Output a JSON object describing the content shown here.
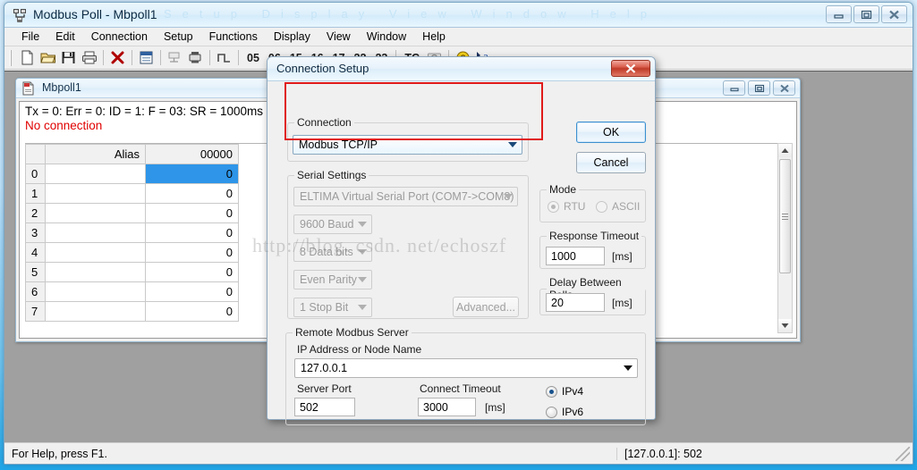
{
  "window": {
    "title": "Modbus Poll - Mbpoll1",
    "app_icon": "modbus-poll-icon",
    "controls": [
      {
        "name": "minimize-button",
        "glyph": "minimize-icon"
      },
      {
        "name": "restore-button",
        "glyph": "restore-icon"
      },
      {
        "name": "close-button",
        "glyph": "close-icon"
      }
    ]
  },
  "menubar": {
    "items": [
      {
        "label": "File"
      },
      {
        "label": "Edit"
      },
      {
        "label": "Connection"
      },
      {
        "label": "Setup"
      },
      {
        "label": "Functions"
      },
      {
        "label": "Display"
      },
      {
        "label": "View"
      },
      {
        "label": "Window"
      },
      {
        "label": "Help"
      }
    ]
  },
  "toolbar": {
    "icons": [
      "new-document-icon",
      "open-folder-icon",
      "save-disk-icon",
      "print-icon",
      "delete-red-x-icon",
      "window-properties-icon",
      "read-write-definition-icon",
      "poll-device-icon",
      "pulse-signal-icon"
    ],
    "function_codes": [
      "05",
      "06",
      "15",
      "16",
      "17",
      "22",
      "23"
    ],
    "tc_label": "TC",
    "tail_icons": [
      "camera-icon",
      "about-help-icon",
      "context-help-icon"
    ]
  },
  "child_window": {
    "title": "Mbpoll1",
    "icon": "document-icon",
    "controls": [
      {
        "name": "minimize-button",
        "glyph": "minimize-icon"
      },
      {
        "name": "restore-button",
        "glyph": "restore-icon"
      },
      {
        "name": "close-button",
        "glyph": "close-icon"
      }
    ],
    "status_line": "Tx = 0: Err = 0: ID = 1: F = 03: SR = 1000ms",
    "connection_status": "No connection",
    "grid": {
      "headers": [
        "",
        "Alias",
        "00000"
      ],
      "rows": [
        {
          "index": "0",
          "alias": "",
          "value": "0",
          "selected": true
        },
        {
          "index": "1",
          "alias": "",
          "value": "0",
          "selected": false
        },
        {
          "index": "2",
          "alias": "",
          "value": "0",
          "selected": false
        },
        {
          "index": "3",
          "alias": "",
          "value": "0",
          "selected": false
        },
        {
          "index": "4",
          "alias": "",
          "value": "0",
          "selected": false
        },
        {
          "index": "5",
          "alias": "",
          "value": "0",
          "selected": false
        },
        {
          "index": "6",
          "alias": "",
          "value": "0",
          "selected": false
        },
        {
          "index": "7",
          "alias": "",
          "value": "0",
          "selected": false
        }
      ]
    }
  },
  "dialog": {
    "title": "Connection Setup",
    "close_glyph": "close-icon",
    "ok_label": "OK",
    "cancel_label": "Cancel",
    "connection": {
      "legend": "Connection",
      "value": "Modbus TCP/IP"
    },
    "serial": {
      "legend": "Serial Settings",
      "port": "ELTIMA Virtual Serial Port (COM7->COM8)",
      "baud": "9600 Baud",
      "data_bits": "8 Data bits",
      "parity": "Even Parity",
      "stop_bits": "1 Stop Bit",
      "advanced_label": "Advanced..."
    },
    "mode": {
      "legend": "Mode",
      "rtu_label": "RTU",
      "ascii_label": "ASCII",
      "selected": "RTU"
    },
    "response_timeout": {
      "legend": "Response Timeout",
      "value": "1000",
      "unit": "[ms]"
    },
    "delay_between_polls": {
      "legend": "Delay Between Polls",
      "value": "20",
      "unit": "[ms]"
    },
    "remote_server": {
      "legend": "Remote Modbus Server",
      "ip_label": "IP Address or Node Name",
      "ip_value": "127.0.0.1",
      "port_label": "Server Port",
      "port_value": "502",
      "connect_timeout_label": "Connect Timeout",
      "connect_timeout_value": "3000",
      "connect_timeout_unit": "[ms]",
      "ipv4_label": "IPv4",
      "ipv6_label": "IPv6",
      "ip_version_selected": "IPv4"
    }
  },
  "statusbar": {
    "help_text": "For Help, press F1.",
    "connection_text": "[127.0.0.1]: 502"
  },
  "watermark": {
    "text": "http://blog. csdn. net/echoszf"
  },
  "colors": {
    "accent_blue": "#2e95e8",
    "error_red": "#e00000",
    "highlight_box": "#e01a1a",
    "mdi_background": "#a0a0a0"
  }
}
